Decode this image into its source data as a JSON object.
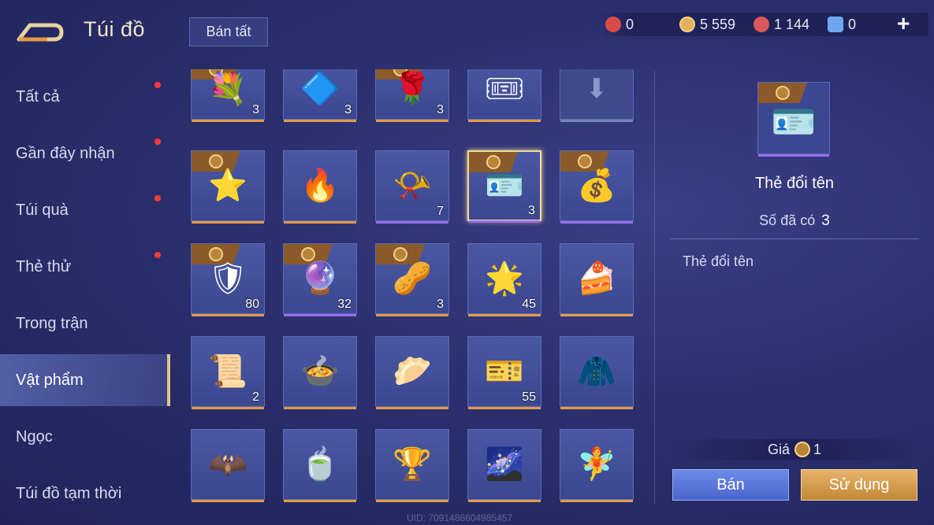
{
  "header": {
    "title": "Túi đồ",
    "sell_all_label": "Bán tất",
    "currencies": [
      {
        "icon": "red-gem-icon",
        "value": "0",
        "color": "#d94a4a"
      },
      {
        "icon": "gold-coin-icon",
        "value": "5 559",
        "color": "#e0b25a"
      },
      {
        "icon": "red-crystal-icon",
        "value": "1 144",
        "color": "#d9585a"
      },
      {
        "icon": "blue-ticket-icon",
        "value": "0",
        "color": "#6fa7ef"
      }
    ],
    "add_label": "+"
  },
  "sidebar": {
    "items": [
      {
        "label": "Tất cả",
        "dot": true
      },
      {
        "label": "Gần đây nhận",
        "dot": true
      },
      {
        "label": "Túi quà",
        "dot": true
      },
      {
        "label": "Thẻ thử",
        "dot": true
      },
      {
        "label": "Trong trận",
        "dot": false
      },
      {
        "label": "Vật phẩm",
        "dot": false,
        "active": true
      },
      {
        "label": "Ngọc",
        "dot": false
      },
      {
        "label": "Túi đồ tạm thời",
        "dot": false
      }
    ]
  },
  "grid": {
    "items": [
      {
        "icon": "rose-bouquet-icon",
        "count": "3",
        "rarity": "orange"
      },
      {
        "icon": "purple-emblem-icon",
        "count": "3",
        "rarity": "orange"
      },
      {
        "icon": "flower-bouquet-icon",
        "count": "3",
        "rarity": "orange"
      },
      {
        "icon": "red-ticket-icon",
        "count": "",
        "rarity": "orange"
      },
      {
        "icon": "download-icon",
        "count": "",
        "rarity": "orange"
      },
      {
        "icon": "star-ticket-icon",
        "count": "",
        "rarity": "orange"
      },
      {
        "icon": "fire-orb-icon",
        "count": "",
        "rarity": "orange"
      },
      {
        "icon": "golden-horn-icon",
        "count": "7",
        "rarity": "purple"
      },
      {
        "icon": "rename-card-icon",
        "count": "3",
        "rarity": "purple",
        "selected": true
      },
      {
        "icon": "coin-card-x2-icon",
        "count": "",
        "rarity": "purple"
      },
      {
        "icon": "knight-helmet-card-icon",
        "count": "80",
        "rarity": "orange"
      },
      {
        "icon": "silver-orb-icon",
        "count": "32",
        "rarity": "purple"
      },
      {
        "icon": "treasure-card-icon",
        "count": "3",
        "rarity": "orange"
      },
      {
        "icon": "crystal-star-icon",
        "count": "45",
        "rarity": "orange"
      },
      {
        "icon": "cake-icon",
        "count": "",
        "rarity": "orange"
      },
      {
        "icon": "scroll-map-icon",
        "count": "2",
        "rarity": "orange"
      },
      {
        "icon": "soup-bowl-icon",
        "count": "",
        "rarity": "orange"
      },
      {
        "icon": "dumpling-icon",
        "count": "",
        "rarity": "orange"
      },
      {
        "icon": "golden-ticket-icon",
        "count": "55",
        "rarity": "orange"
      },
      {
        "icon": "outfit-icon",
        "count": "",
        "rarity": "orange"
      },
      {
        "icon": "pet-bat-icon",
        "count": "",
        "rarity": "orange"
      },
      {
        "icon": "tea-cup-icon",
        "count": "",
        "rarity": "orange"
      },
      {
        "icon": "golden-chalice-icon",
        "count": "",
        "rarity": "orange"
      },
      {
        "icon": "galaxy-orb-icon",
        "count": "",
        "rarity": "orange"
      },
      {
        "icon": "fairy-girl-icon",
        "count": "",
        "rarity": "orange"
      }
    ]
  },
  "detail": {
    "icon": "rename-card-icon",
    "name": "Thẻ đổi tên",
    "owned_label": "Số đã có",
    "owned_value": "3",
    "description": "Thẻ đổi tên",
    "price_label": "Giá",
    "price_value": "1",
    "sell_label": "Bán",
    "use_label": "Sử dụng"
  },
  "footer": {
    "uid": "UID: 7091486604985457"
  }
}
